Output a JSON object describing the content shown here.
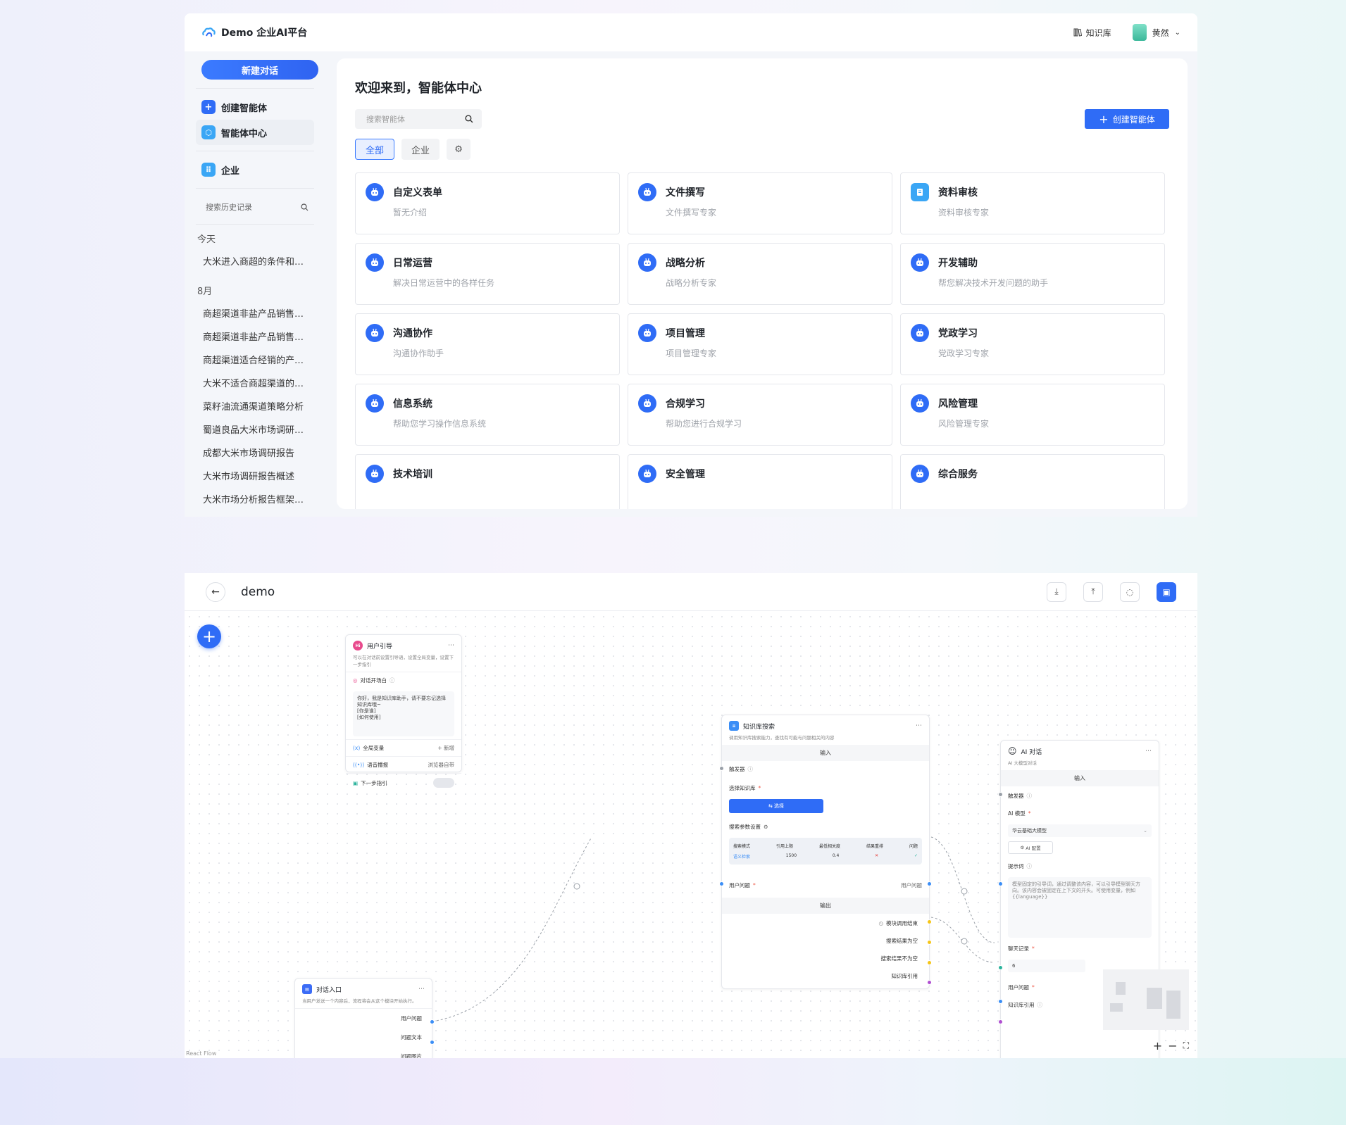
{
  "app": {
    "logo_text": "Demo 企业AI平台",
    "knowledge_base_label": "知识库",
    "user_name": "黄然"
  },
  "sidebar": {
    "new_chat_label": "新建对话",
    "items": [
      {
        "label": "创建智能体",
        "icon": "+"
      },
      {
        "label": "智能体中心",
        "icon": "⬡"
      },
      {
        "label": "企业",
        "icon": "⠿"
      }
    ],
    "history_search_placeholder": "搜索历史记录",
    "history_groups": [
      {
        "title": "今天",
        "items": [
          "大米进入商超的条件和步骤"
        ]
      },
      {
        "title": "8月",
        "items": [
          "商超渠道非盐产品销售分析",
          "商超渠道非盐产品销售情...",
          "商超渠道适合经销的产品...",
          "大米不适合商超渠道的原...",
          "菜籽油流通渠道策略分析",
          "蜀道良品大米市场调研报告",
          "成都大米市场调研报告",
          "大米市场调研报告概述",
          "大米市场分析报告框架与..."
        ]
      }
    ]
  },
  "main": {
    "title": "欢迎来到，智能体中心",
    "search_placeholder": "搜索智能体",
    "create_label": "创建智能体",
    "filters": [
      "全部",
      "企业"
    ],
    "cards": [
      {
        "title": "自定义表单",
        "desc": "暂无介绍"
      },
      {
        "title": "文件撰写",
        "desc": "文件撰写专家"
      },
      {
        "title": "资料审核",
        "desc": "资料审核专家"
      },
      {
        "title": "日常运营",
        "desc": "解决日常运营中的各样任务"
      },
      {
        "title": "战略分析",
        "desc": "战略分析专家"
      },
      {
        "title": "开发辅助",
        "desc": "帮您解决技术开发问题的助手"
      },
      {
        "title": "沟通协作",
        "desc": "沟通协作助手"
      },
      {
        "title": "项目管理",
        "desc": "项目管理专家"
      },
      {
        "title": "党政学习",
        "desc": "党政学习专家"
      },
      {
        "title": "信息系统",
        "desc": "帮助您学习操作信息系统"
      },
      {
        "title": "合规学习",
        "desc": "帮助您进行合规学习"
      },
      {
        "title": "风险管理",
        "desc": "风险管理专家"
      },
      {
        "title": "技术培训",
        "desc": ""
      },
      {
        "title": "安全管理",
        "desc": ""
      },
      {
        "title": "综合服务",
        "desc": ""
      }
    ]
  },
  "flow": {
    "title": "demo",
    "attribution": "React Flow",
    "nodes": {
      "guide": {
        "title": "用户引导",
        "sub": "可以在对话前设置引导语，设置全局变量，设置下一步指引",
        "opening_label": "对话开场白",
        "opening_text": [
          "你好，我是知识库助手，请不要忘记选择知识库哦~",
          "[你是谁]",
          "[如何使用]"
        ],
        "global_var_label": "全局变量",
        "global_var_action": "+ 新增",
        "voice_label": "语音播报",
        "voice_value": "浏览器自带",
        "next_label": "下一步指引"
      },
      "kb": {
        "title": "知识库搜索",
        "sub": "调用知识库搜索能力，查找有可能与问题相关的内容",
        "input_section": "输入",
        "trigger_label": "触发器",
        "select_kb_label": "选择知识库",
        "select_button": "选择",
        "params_label": "搜索参数设置",
        "param_headers": [
          "搜索模式",
          "引用上限",
          "最低相关度",
          "结果重排",
          "问题"
        ],
        "param_values": [
          "语义检索",
          "1500",
          "0.4",
          "✕",
          "✓"
        ],
        "user_question_in": "用户问题",
        "user_question_out": "用户问题",
        "output_section": "输出",
        "outputs": [
          "模块调用结束",
          "搜索结果为空",
          "搜索结果不为空",
          "知识库引用"
        ]
      },
      "ai": {
        "title": "AI 对话",
        "sub": "AI 大模型对话",
        "input_section": "输入",
        "trigger_label": "触发器",
        "model_label": "AI 模型",
        "model_value": "华云基础大模型",
        "config_label": "AI 配置",
        "prompt_label": "提示词",
        "prompt_text": "模型固定的引导词，通过调整该内容，可以引导模型聊天方向。该内容会被固定在上下文的开头。可使用变量，例如 {{language}}",
        "history_label": "聊天记录",
        "history_value": "6",
        "user_question": "用户问题",
        "kb_ref": "知识库引用"
      },
      "entry": {
        "title": "对话入口",
        "sub": "当用户发送一个内容后，流程将会从这个模块开始执行。",
        "outputs": [
          "用户问题",
          "问题文本",
          "问题图片"
        ]
      }
    }
  }
}
